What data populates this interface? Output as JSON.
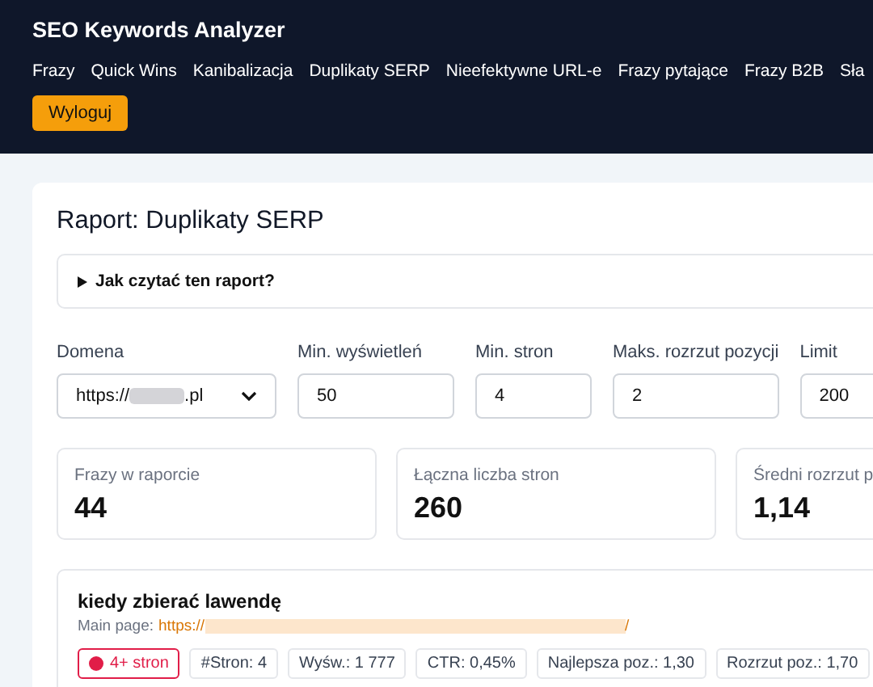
{
  "header": {
    "title": "SEO Keywords Analyzer",
    "nav": [
      {
        "label": "Frazy"
      },
      {
        "label": "Quick Wins"
      },
      {
        "label": "Kanibalizacja"
      },
      {
        "label": "Duplikaty SERP"
      },
      {
        "label": "Nieefektywne URL-e"
      },
      {
        "label": "Frazy pytające"
      },
      {
        "label": "Frazy B2B"
      },
      {
        "label": "Sła"
      }
    ],
    "logout_button": "Wyloguj"
  },
  "report": {
    "title": "Raport: Duplikaty SERP",
    "help": {
      "label": "Jak czytać ten raport?",
      "expanded": false
    },
    "filters": [
      {
        "kind": "select",
        "label": "Domena",
        "value_prefix": "https://",
        "value_suffix": ".pl"
      },
      {
        "kind": "input",
        "label": "Min. wyświetleń",
        "value": "50"
      },
      {
        "kind": "input",
        "label": "Min. stron",
        "value": "4"
      },
      {
        "kind": "input",
        "label": "Maks. rozrzut pozycji",
        "value": "2"
      },
      {
        "kind": "input",
        "label": "Limit",
        "value": "200"
      }
    ],
    "stats": [
      {
        "label": "Frazy w raporcie",
        "value": "44"
      },
      {
        "label": "Łączna liczba stron",
        "value": "260"
      },
      {
        "label": "Średni rozrzut p",
        "value": "1,14"
      }
    ],
    "keywords": [
      {
        "title": "kiedy zbierać lawendę",
        "main_page_label": "Main page:",
        "main_page_prefix": "https://",
        "main_page_suffix": "/",
        "tags": [
          {
            "kind": "severity",
            "text": "4+ stron",
            "color": "#e11d48"
          },
          {
            "kind": "plain",
            "text": "#Stron: 4"
          },
          {
            "kind": "plain",
            "text": "Wyśw.: 1 777"
          },
          {
            "kind": "plain",
            "text": "CTR: 0,45%"
          },
          {
            "kind": "plain",
            "text": "Najlepsza poz.: 1,30"
          },
          {
            "kind": "plain",
            "text": "Rozrzut poz.: 1,70"
          }
        ]
      }
    ]
  }
}
